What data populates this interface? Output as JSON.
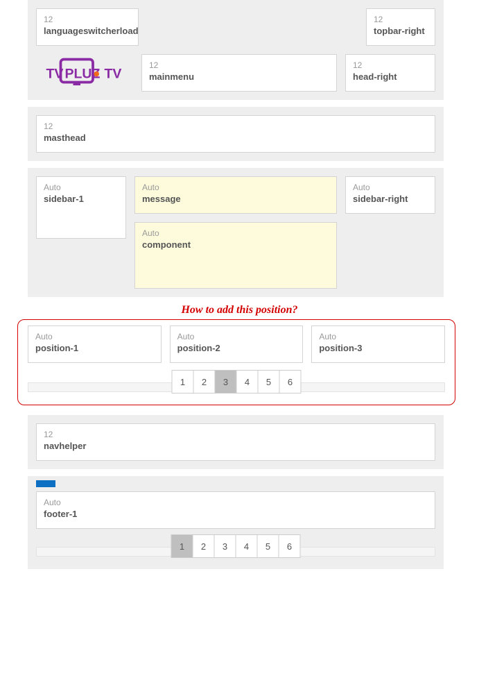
{
  "topbar": {
    "left": {
      "size": "12",
      "name": "languageswitcherload"
    },
    "right": {
      "size": "12",
      "name": "topbar-right"
    }
  },
  "header": {
    "mainmenu": {
      "size": "12",
      "name": "mainmenu"
    },
    "headright": {
      "size": "12",
      "name": "head-right"
    }
  },
  "masthead": {
    "size": "12",
    "name": "masthead"
  },
  "content": {
    "sidebar1": {
      "size": "Auto",
      "name": "sidebar-1"
    },
    "message": {
      "size": "Auto",
      "name": "message"
    },
    "component": {
      "size": "Auto",
      "name": "component"
    },
    "sidebarRight": {
      "size": "Auto",
      "name": "sidebar-right"
    }
  },
  "annotation": "How to add this position?",
  "positions": {
    "p1": {
      "size": "Auto",
      "name": "position-1"
    },
    "p2": {
      "size": "Auto",
      "name": "position-2"
    },
    "p3": {
      "size": "Auto",
      "name": "position-3"
    },
    "pages": [
      "1",
      "2",
      "3",
      "4",
      "5",
      "6"
    ],
    "active": "3"
  },
  "navhelper": {
    "size": "12",
    "name": "navhelper"
  },
  "footer": {
    "f1": {
      "size": "Auto",
      "name": "footer-1"
    },
    "pages": [
      "1",
      "2",
      "3",
      "4",
      "5",
      "6"
    ],
    "active": "1"
  }
}
